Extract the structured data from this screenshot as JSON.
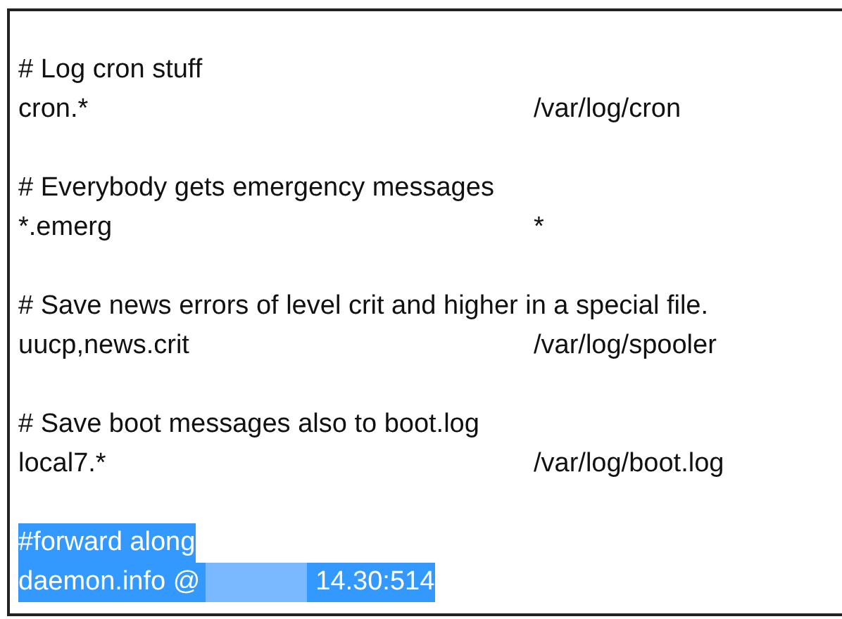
{
  "editor": {
    "lines": [
      {
        "kind": "blank"
      },
      {
        "kind": "comment",
        "text": "# Log cron stuff",
        "selected": false
      },
      {
        "kind": "rule",
        "selector": "cron.*",
        "action": "/var/log/cron",
        "selected": false
      },
      {
        "kind": "blank"
      },
      {
        "kind": "comment",
        "text": "# Everybody gets emergency messages",
        "selected": false
      },
      {
        "kind": "rule",
        "selector": "*.emerg",
        "action": "*",
        "selected": false
      },
      {
        "kind": "blank"
      },
      {
        "kind": "comment",
        "text": "# Save news errors of level crit and higher in a special file.",
        "selected": false
      },
      {
        "kind": "rule",
        "selector": "uucp,news.crit",
        "action": "/var/log/spooler",
        "selected": false
      },
      {
        "kind": "blank"
      },
      {
        "kind": "comment",
        "text": "# Save boot messages also to boot.log",
        "selected": false
      },
      {
        "kind": "rule",
        "selector": "local7.*",
        "action": "/var/log/boot.log",
        "selected": false
      },
      {
        "kind": "blank"
      },
      {
        "kind": "comment",
        "text": "#forward along",
        "selected": true
      },
      {
        "kind": "redacted",
        "before": "daemon.info @",
        "after": "14.30:514",
        "selected": true
      }
    ]
  }
}
